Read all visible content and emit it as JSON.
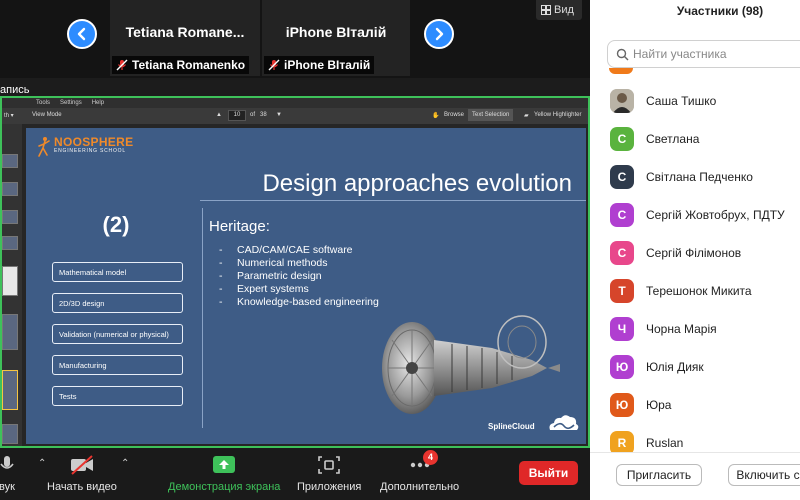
{
  "strip": {
    "tile1": {
      "title": "Tetiana  Romane...",
      "label": "Tetiana Romanenko"
    },
    "tile2": {
      "title": "iPhone ВІталій",
      "label": "iPhone ВІталій"
    },
    "view_label": "Вид"
  },
  "recording_label": "апись",
  "viewer": {
    "menu": [
      "Tools",
      "Settings",
      "Help"
    ],
    "view_mode": "View Mode",
    "page_current": "10",
    "page_of": "of",
    "page_total": "38",
    "browse": "Browse",
    "text_selection": "Text Selection",
    "highlighter": "Yellow Highlighter"
  },
  "slide": {
    "logo_name": "NOOSPHERE",
    "logo_sub": "ENGINEERING SCHOOL",
    "title": "Design approaches evolution",
    "step": "(2)",
    "boxes": [
      "Mathematical model",
      "2D/3D design",
      "Validation (numerical or physical)",
      "Manufacturing",
      "Tests"
    ],
    "heritage_title": "Heritage:",
    "heritage_items": [
      "CAD/CAM/CAE software",
      "Numerical methods",
      "Parametric design",
      "Expert systems",
      "Knowledge-based engineering"
    ],
    "brand": "SplineCloud"
  },
  "controls": {
    "audio": "вук",
    "video": "Начать видео",
    "share": "Демонстрация экрана",
    "apps": "Приложения",
    "more": "Дополнительно",
    "more_badge": "4",
    "leave": "Выйти"
  },
  "participants": {
    "title": "Участники (98)",
    "search_placeholder": "Найти участника",
    "list": [
      {
        "initial": "",
        "name": "Саша Тишко",
        "color": "#c9c4b9"
      },
      {
        "initial": "С",
        "name": "Светлана",
        "color": "#5ab33e"
      },
      {
        "initial": "С",
        "name": "Світлана Педченко",
        "color": "#2f3b4c"
      },
      {
        "initial": "С",
        "name": "Сергій Жовтобрух, ПДТУ",
        "color": "#b03fd0"
      },
      {
        "initial": "С",
        "name": "Сергій Філімонов",
        "color": "#e8478b"
      },
      {
        "initial": "Т",
        "name": "Терешонок Микита",
        "color": "#d6452b"
      },
      {
        "initial": "Ч",
        "name": "Чорна Марія",
        "color": "#b03fd0"
      },
      {
        "initial": "Ю",
        "name": "Юлія Дияк",
        "color": "#b03fd0"
      },
      {
        "initial": "Ю",
        "name": "Юра",
        "color": "#e0591a"
      },
      {
        "initial": "R",
        "name": "Ruslan",
        "color": "#f0a21f"
      }
    ],
    "invite": "Пригласить",
    "enable": "Включить с"
  },
  "colors": {
    "accent": "#2d8cff",
    "share_border": "#3ec15a",
    "leave": "#e02828",
    "slide_bg": "#3e5c86"
  }
}
